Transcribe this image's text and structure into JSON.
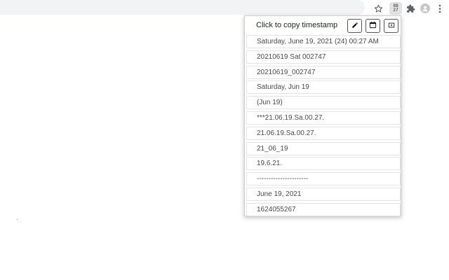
{
  "browser": {
    "toolbar_icons": [
      "star-icon",
      "extension-calendar-icon",
      "puzzle-icon",
      "avatar-icon",
      "kebab-menu-icon"
    ],
    "ext_badge_top": "8B",
    "ext_badge_bottom": "27"
  },
  "popup": {
    "title": "Click to copy timestamp",
    "buttons": [
      "edit-icon",
      "calendar-icon",
      "open-tab-icon"
    ],
    "items": [
      "Saturday, June 19, 2021 (24) 00:27 AM",
      "20210619 Sat 002747",
      "20210619_002747",
      "Saturday, Jun 19",
      "(Jun 19)",
      "***21.06.19.Sa.00.27.",
      "21.06.19.Sa.00.27.",
      "21_06_19",
      "19.6.21.",
      "----------------------",
      "June 19, 2021",
      "1624055267"
    ]
  }
}
